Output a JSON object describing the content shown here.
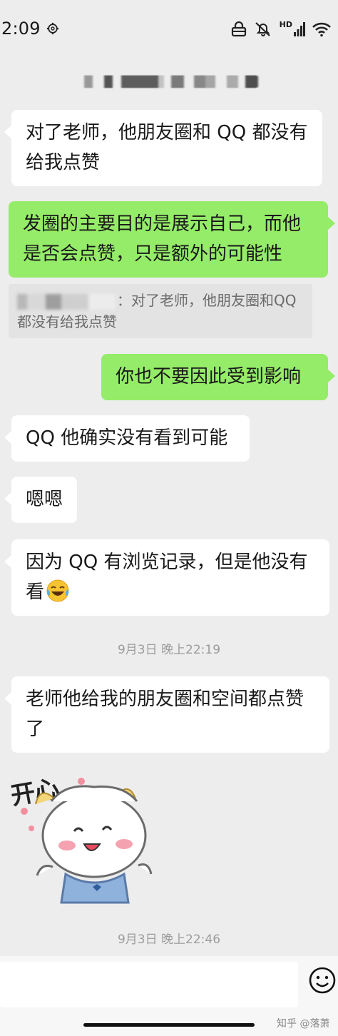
{
  "status_bar": {
    "time": "2:09",
    "hd_label": "HD",
    "icons": [
      "gear-icon",
      "lock-icon",
      "muted-bell-icon",
      "signal-icon",
      "wifi-icon"
    ]
  },
  "title_bar": {
    "title_redacted": true
  },
  "messages": [
    {
      "side": "in",
      "text": "对了老师，他朋友圈和 QQ 都没有给我点赞"
    },
    {
      "side": "out",
      "text": "发圈的主要目的是展示自己，而他是否会点赞，只是额外的可能性"
    },
    {
      "side": "quote",
      "text": "：对了老师，他朋友圈和QQ都没有给我点赞"
    },
    {
      "side": "out",
      "text": "你也不要因此受到影响"
    },
    {
      "side": "in",
      "text": "QQ 他确实没有看到可能"
    },
    {
      "side": "in",
      "text": "嗯嗯"
    },
    {
      "side": "in",
      "text": "因为 QQ 有浏览记录，但是他没有看"
    },
    {
      "side": "time",
      "text": "9月3日 晚上22:19"
    },
    {
      "side": "in",
      "text": "老师他给我的朋友圈和空间都点赞了"
    },
    {
      "side": "sticker",
      "text": "开心"
    },
    {
      "side": "time",
      "text": "9月3日 晚上22:46"
    }
  ],
  "watermark": "知乎 @落萧",
  "colors": {
    "background": "#ededed",
    "incoming_bubble": "#ffffff",
    "outgoing_bubble": "#95ec69",
    "timestamp": "#9c9c9c"
  }
}
